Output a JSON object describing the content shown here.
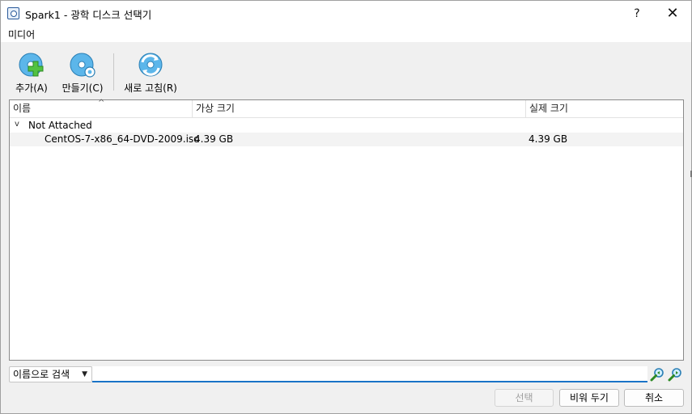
{
  "window": {
    "title": "Spark1 - 광학 디스크 선택기",
    "help_label": "?",
    "close_label": "✕"
  },
  "menu": {
    "items": [
      {
        "label": "미디어"
      }
    ]
  },
  "toolbar": {
    "add_label": "추가(A)",
    "create_label": "만들기(C)",
    "refresh_label": "새로 고침(R)"
  },
  "table": {
    "columns": [
      "이름",
      "가상 크기",
      "실제 크기"
    ],
    "sort_indicator": "^",
    "groups": [
      {
        "label": "Not Attached",
        "expand_glyph": "v",
        "rows": [
          {
            "name": "CentOS-7-x86_64-DVD-2009.iso",
            "virtual_size": "4.39 GB",
            "actual_size": "4.39 GB"
          }
        ]
      }
    ]
  },
  "search": {
    "mode": "이름으로 검색",
    "value": "",
    "placeholder": ""
  },
  "buttons": {
    "select": "선택",
    "clear": "비워 두기",
    "cancel": "취소"
  },
  "colors": {
    "accent": "#1a73c7",
    "icon_blue": "#3ea6e0",
    "icon_green": "#4cbe3c"
  }
}
